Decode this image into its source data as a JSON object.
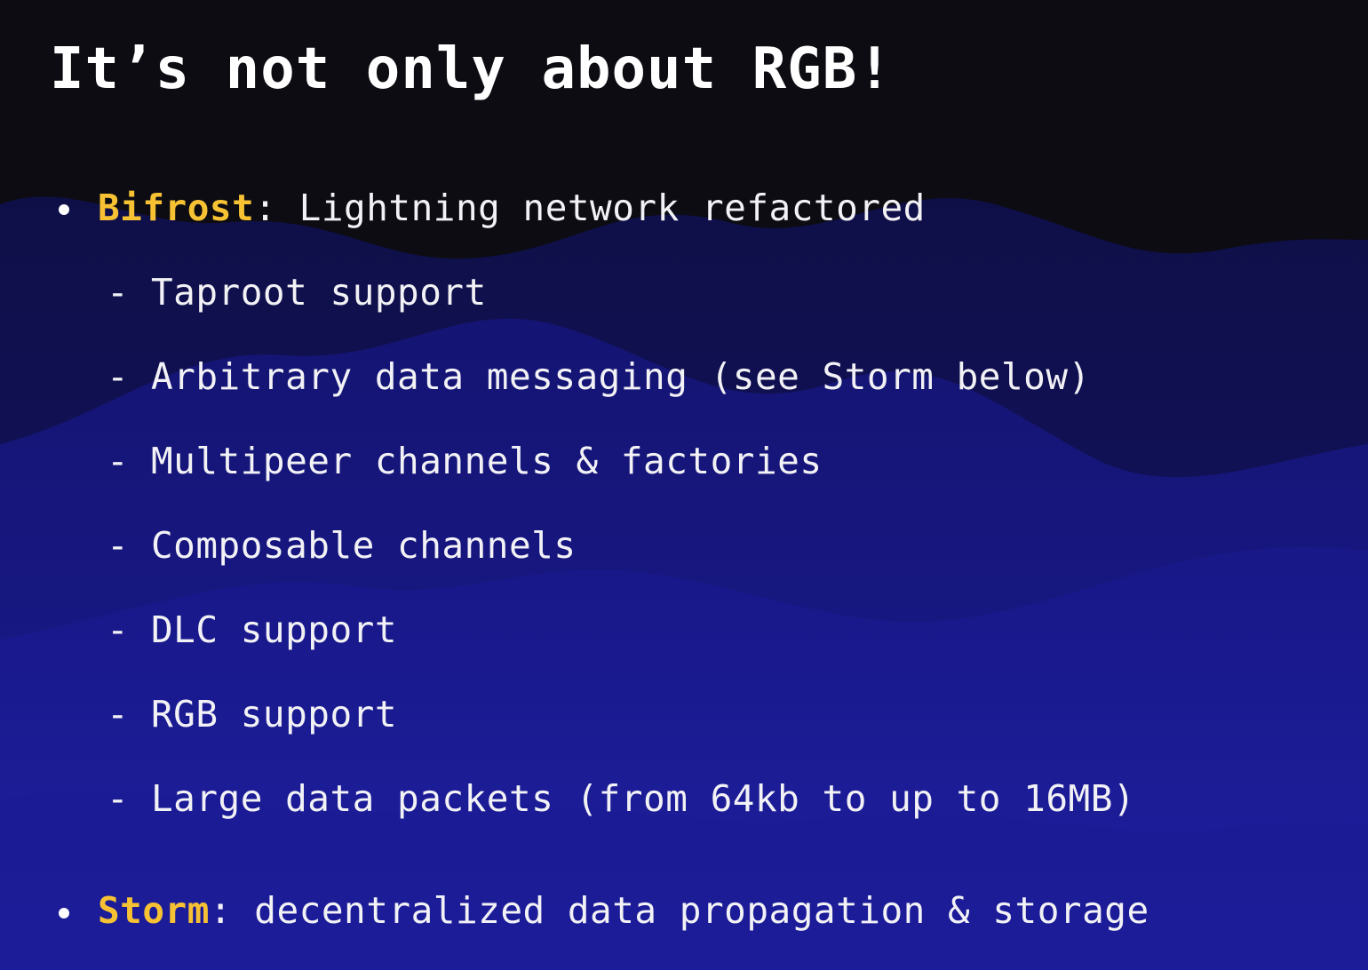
{
  "slide": {
    "title": "It’s not only about RGB!",
    "bullets": [
      {
        "term": "Bifrost",
        "separator": ":",
        "description": " Lightning network refactored",
        "subitems": [
          "Taproot support",
          "Arbitrary data messaging (see Storm below)",
          "Multipeer channels & factories",
          "Composable channels",
          "DLC support",
          "RGB support",
          "Large data packets (from 64kb to up to 16MB)"
        ]
      },
      {
        "term": "Storm",
        "separator": ":",
        "description": " decentralized data propagation & storage"
      }
    ],
    "dash": "-"
  },
  "colors": {
    "background": "#0c0c12",
    "wave": "#1a1a8c",
    "text": "#f2f2f6",
    "highlight": "#f6c233"
  }
}
